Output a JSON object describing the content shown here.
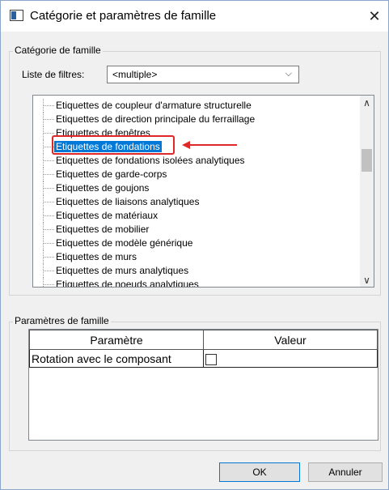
{
  "window": {
    "title": "Catégorie et paramètres de famille",
    "close_glyph": "✕"
  },
  "category_group": {
    "legend": "Catégorie de famille",
    "filter_label": "Liste de filtres:",
    "filter_value": "<multiple>",
    "items": [
      {
        "label": "Etiquettes de coupleur d'armature structurelle",
        "selected": false
      },
      {
        "label": "Etiquettes de direction principale du ferraillage",
        "selected": false
      },
      {
        "label": "Etiquettes de fenêtres",
        "selected": false
      },
      {
        "label": "Etiquettes de fondations",
        "selected": true
      },
      {
        "label": "Etiquettes de fondations isolées analytiques",
        "selected": false
      },
      {
        "label": "Etiquettes de garde-corps",
        "selected": false
      },
      {
        "label": "Etiquettes de goujons",
        "selected": false
      },
      {
        "label": "Etiquettes de liaisons analytiques",
        "selected": false
      },
      {
        "label": "Etiquettes de matériaux",
        "selected": false
      },
      {
        "label": "Etiquettes de mobilier",
        "selected": false
      },
      {
        "label": "Etiquettes de modèle générique",
        "selected": false
      },
      {
        "label": "Etiquettes de murs",
        "selected": false
      },
      {
        "label": "Etiquettes de murs analytiques",
        "selected": false
      },
      {
        "label": "Etiquettes de noeuds analytiques",
        "selected": false
      }
    ],
    "highlight_color": "#e02828",
    "selection_color": "#0078d7"
  },
  "params_group": {
    "legend": "Paramètres de famille",
    "col_param": "Paramètre",
    "col_value": "Valeur",
    "rows": [
      {
        "param": "Rotation avec le composant",
        "checked": false
      }
    ]
  },
  "buttons": {
    "ok": "OK",
    "cancel": "Annuler"
  }
}
